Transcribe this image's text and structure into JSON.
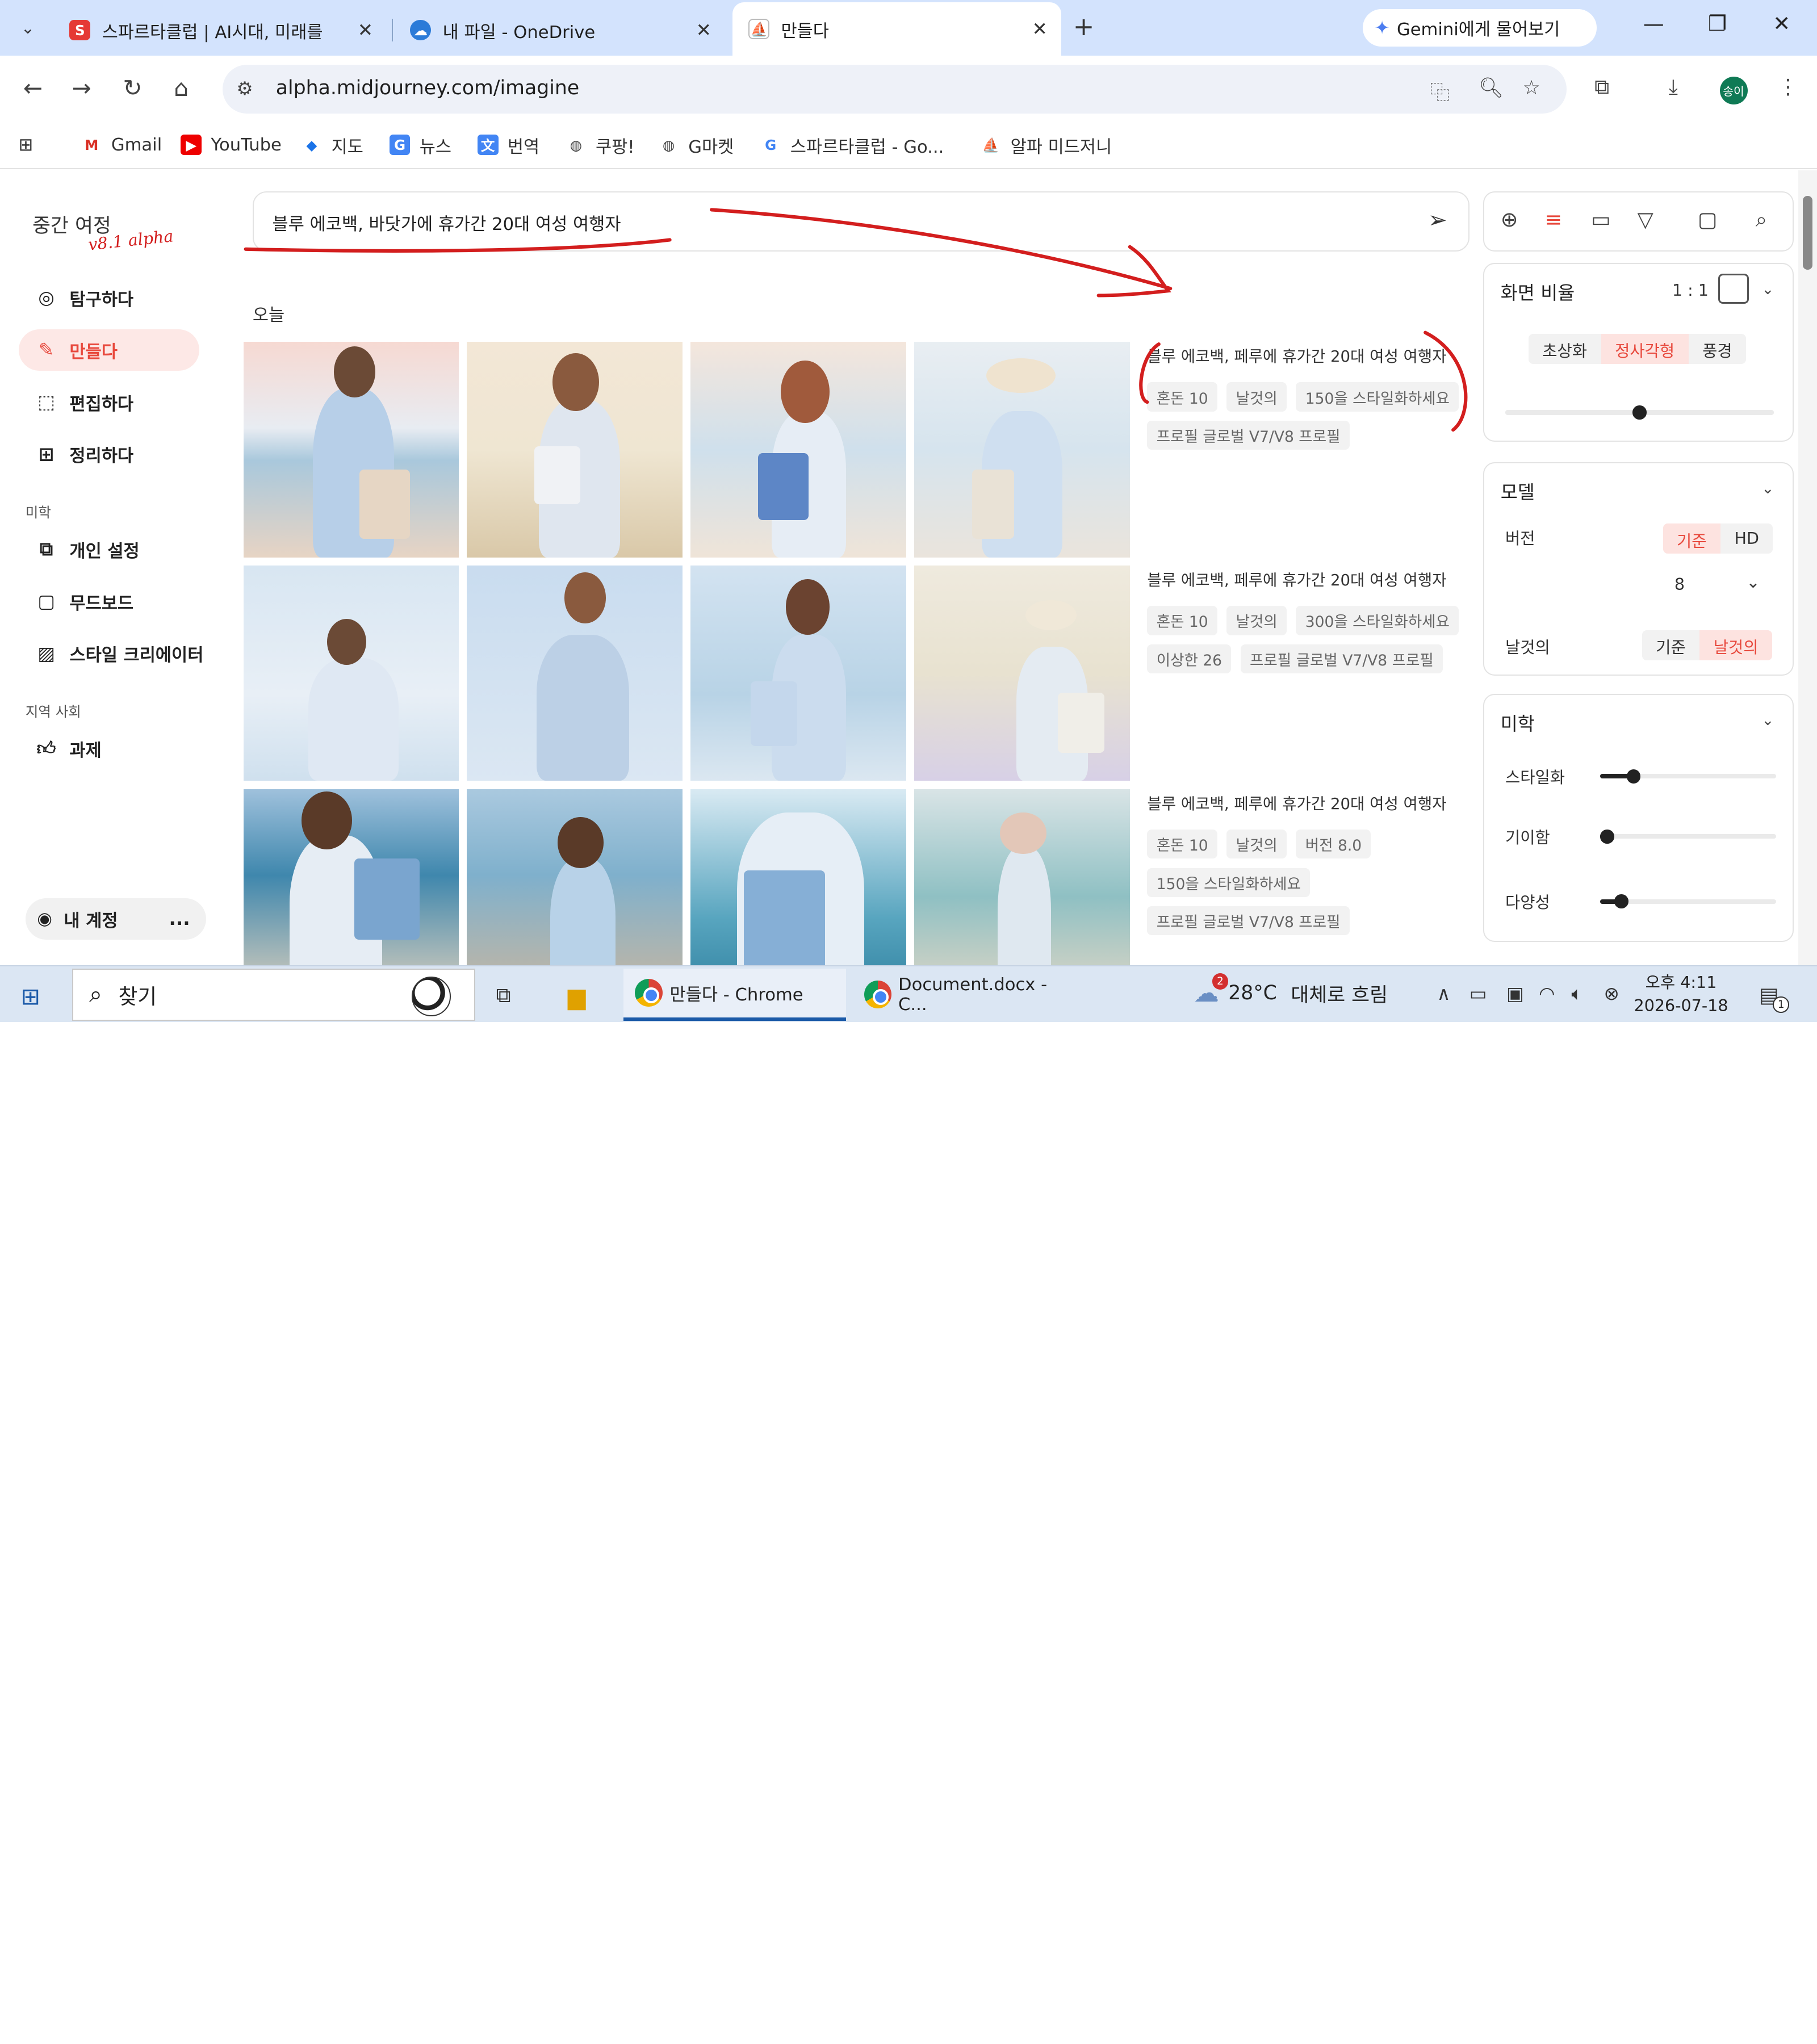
{
  "browser": {
    "tabs": [
      {
        "label": "스파르타클럽 | AI시대, 미래를",
        "icon": "sparta-favicon"
      },
      {
        "label": "내 파일 - OneDrive",
        "icon": "onedrive-icon"
      },
      {
        "label": "만들다",
        "icon": "midjourney-icon",
        "active": true
      }
    ],
    "gemini_button": "Gemini에게 물어보기",
    "url": "alpha.midjourney.com/imagine",
    "profile_initials": "송이",
    "bookmarks": [
      "Gmail",
      "YouTube",
      "지도",
      "뉴스",
      "번역",
      "쿠팡!",
      "G마켓",
      "스파르타클럽 - Go...",
      "알파 미드저니"
    ]
  },
  "sidebar": {
    "brand": "중간 여정",
    "brand_tag": "v8.1 alpha",
    "items": [
      {
        "label": "탐구하다",
        "icon": "compass-icon"
      },
      {
        "label": "만들다",
        "icon": "brush-icon",
        "active": true
      },
      {
        "label": "편집하다",
        "icon": "edit-frame-icon"
      },
      {
        "label": "정리하다",
        "icon": "grid-icon"
      }
    ],
    "section_aesthetics": "미학",
    "aesthetic_items": [
      {
        "label": "개인 설정",
        "icon": "personalize-icon"
      },
      {
        "label": "무드보드",
        "icon": "moodboard-icon"
      },
      {
        "label": "스타일 크리에이터",
        "icon": "style-creator-icon"
      }
    ],
    "section_community": "지역 사회",
    "community_items": [
      {
        "label": "과제",
        "icon": "thumbs-up-icon"
      }
    ],
    "account_label": "내 계정",
    "account_more": "..."
  },
  "prompt": {
    "text": "블루 에코백, 바닷가에 휴가간 20대 여성 여행자"
  },
  "feed": {
    "date_heading": "오늘",
    "jobs": [
      {
        "prompt": "블루 에코백, 페루에 휴가간 20대 여성 여행자",
        "chips": [
          "혼돈 10",
          "날것의",
          "150을 스타일화하세요",
          "프로필 글로벌 V7/V8 프로필"
        ]
      },
      {
        "prompt": "블루 에코백, 페루에 휴가간 20대 여성 여행자",
        "chips": [
          "혼돈 10",
          "날것의",
          "300을 스타일화하세요",
          "이상한 26",
          "프로필 글로벌 V7/V8 프로필"
        ]
      },
      {
        "prompt": "블루 에코백, 페루에 휴가간 20대 여성 여행자",
        "chips": [
          "혼돈 10",
          "날것의",
          "버전 8.0",
          "150을 스타일화하세요",
          "프로필 글로벌 V7/V8 프로필"
        ]
      }
    ]
  },
  "settings": {
    "aspect": {
      "title": "화면 비율",
      "ratio": "1 : 1",
      "options": [
        "초상화",
        "정사각형",
        "풍경"
      ],
      "selected": "정사각형",
      "slider_level": 0.5
    },
    "model": {
      "title": "모델",
      "version_label": "버전",
      "mode_options": [
        "기준",
        "HD"
      ],
      "mode_selected": "기준",
      "version_value": "8",
      "raw_label": "날것의",
      "raw_options": [
        "기준",
        "날것의"
      ],
      "raw_selected": "날것의"
    },
    "aesthetics": {
      "title": "미학",
      "sliders": [
        {
          "label": "스타일화",
          "level": 0.15
        },
        {
          "label": "기이함",
          "level": 0.0
        },
        {
          "label": "다양성",
          "level": 0.08
        }
      ]
    }
  },
  "taskbar": {
    "search_placeholder": "찾기",
    "apps": [
      {
        "label": "만들다 - Chrome",
        "active": true
      },
      {
        "label": "Document.docx - C..."
      }
    ],
    "weather_temp": "28°C",
    "weather_desc": "대체로 흐림",
    "weather_badge": "2",
    "time": "오후 4:11",
    "date": "2026-07-18",
    "notification_count": "1"
  },
  "colors": {
    "accent": "#e8493d",
    "accent_bg": "#fde8e6",
    "tabstrip": "#d3e3fd",
    "annotation_red": "#d31e1e"
  }
}
